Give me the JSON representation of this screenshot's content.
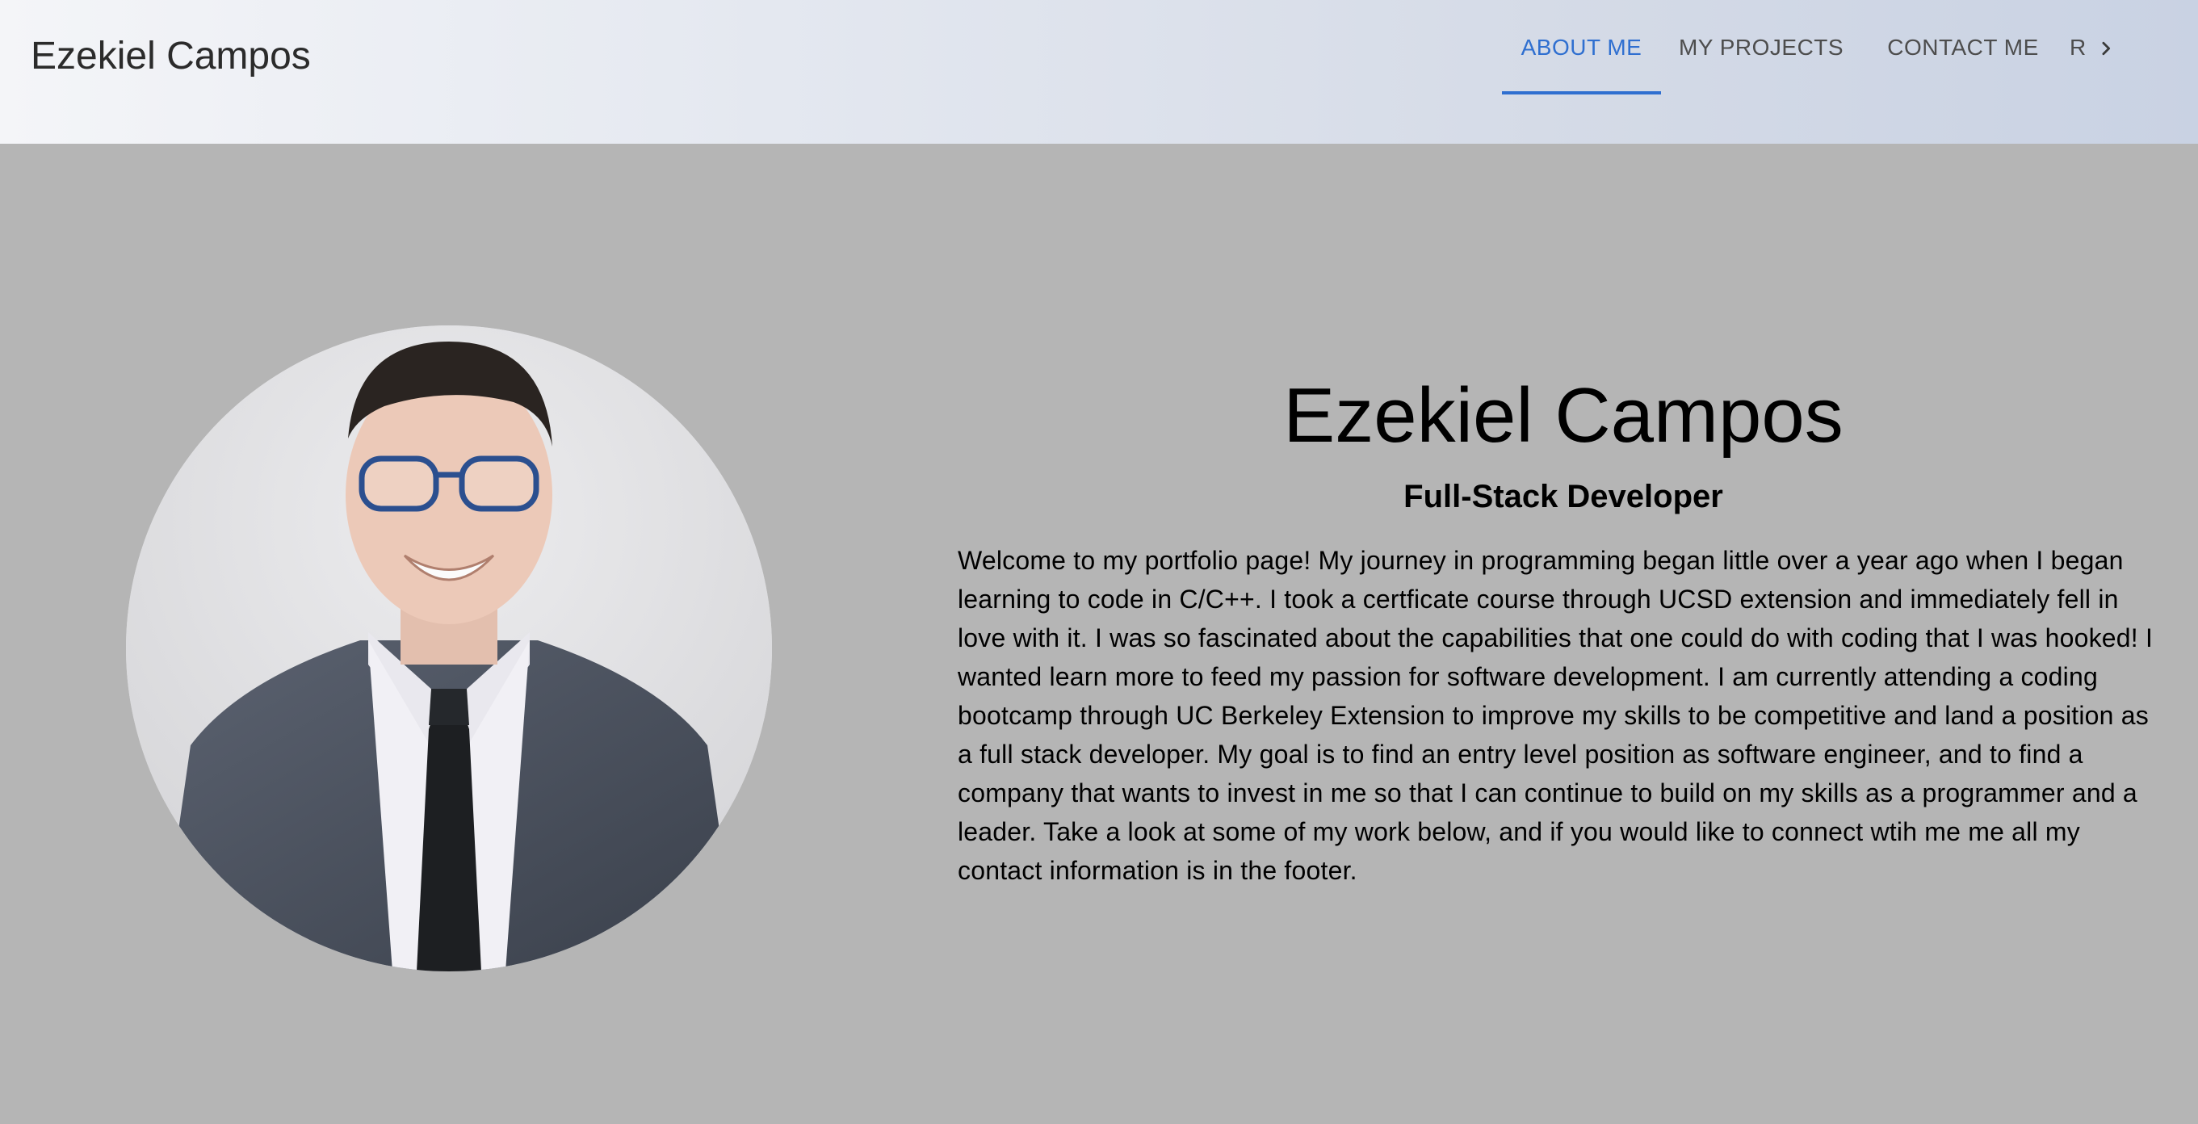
{
  "header": {
    "brand": "Ezekiel Campos",
    "tabs": [
      {
        "label": "ABOUT ME",
        "active": true
      },
      {
        "label": "MY PROJECTS",
        "active": false
      },
      {
        "label": "CONTACT ME",
        "active": false
      },
      {
        "label": "RESUME",
        "active": false
      }
    ],
    "scroll_icon": "chevron-right-icon"
  },
  "profile": {
    "name": "Ezekiel Campos",
    "role": "Full-Stack Developer",
    "bio": "Welcome to my portfolio page! My journey in programming began little over a year ago when I began learning to code in C/C++. I took a certficate course through UCSD extension and immediately fell in love with it. I was so fascinated about the capabilities that one could do with coding that I was hooked! I wanted learn more to feed my passion for software development. I am currently attending a coding bootcamp through UC Berkeley Extension to improve my skills to be competitive and land a position as a full stack developer. My goal is to find an entry level position as software engineer, and to find a company that wants to invest in me so that I can continue to build on my skills as a programmer and a leader. Take a look at some of my work below, and if you would like to connect wtih me me all my contact information is in the footer."
  },
  "colors": {
    "accent": "#2f6fd0",
    "page_bg": "#b5b5b5",
    "tab_text": "#4d4d4d"
  }
}
